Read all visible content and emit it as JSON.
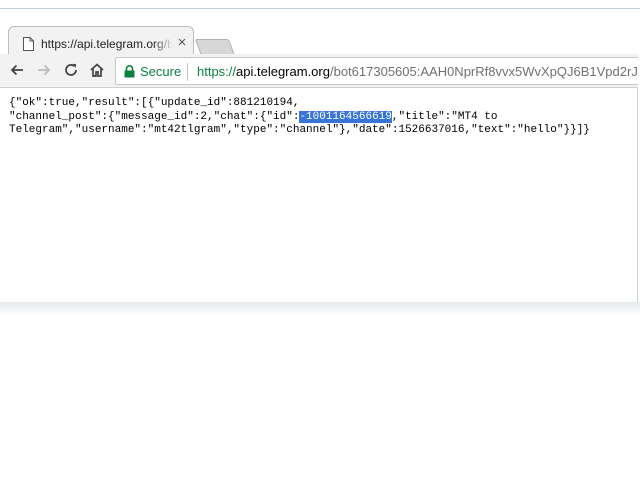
{
  "browser": {
    "tab": {
      "title": "https://api.telegram.org/b",
      "close_glyph": "×",
      "favicon": "page-icon"
    },
    "toolbar": {
      "back_icon": "back-arrow-icon",
      "forward_icon": "forward-arrow-icon",
      "reload_icon": "reload-icon",
      "home_icon": "home-icon"
    },
    "omnibox": {
      "security_label": "Secure",
      "url_scheme": "https://",
      "url_host": "api.telegram.org",
      "url_path": "/bot617305605:AAH0NprRf8vvx5WvXpQJ6B1Vpd2rJ"
    },
    "colors": {
      "secure_green": "#0b8043",
      "selection_blue": "#3875d7",
      "toolbar_bg": "#f2f2f2"
    }
  },
  "page": {
    "line1": "{\"ok\":true,\"result\":[{\"update_id\":881210194,",
    "line2_before": "\"channel_post\":{\"message_id\":2,\"chat\":{\"id\":",
    "line2_selected": "-1001164566619",
    "line2_after": ",\"title\":\"MT4 to",
    "line3": "Telegram\",\"username\":\"mt42tlgram\",\"type\":\"channel\"},\"date\":1526637016,\"text\":\"hello\"}}]}"
  }
}
